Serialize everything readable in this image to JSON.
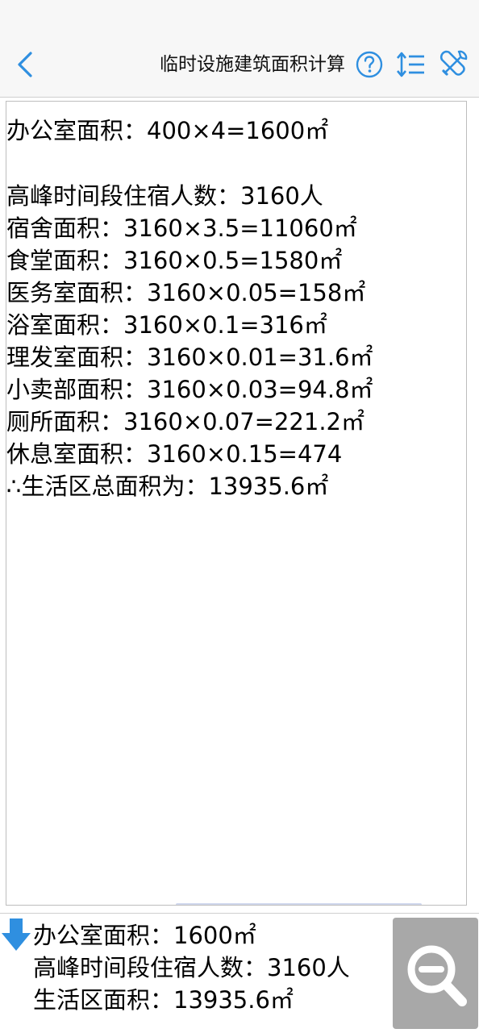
{
  "navbar": {
    "title": "临时设施建筑面积计算"
  },
  "icons": {
    "back": "chevron-left-icon",
    "help": "question-circle-icon",
    "sort": "sort-list-icon",
    "tools": "wrench-screwdriver-icon",
    "down": "arrow-down-icon",
    "zoom": "zoom-out-icon"
  },
  "colors": {
    "accent": "#2f8fe0",
    "zoom_bg": "#a8a8a8"
  },
  "results": [
    "办公室面积：400×4=1600㎡",
    "",
    "高峰时间段住宿人数：3160人",
    "宿舍面积：3160×3.5=11060㎡",
    "食堂面积：3160×0.5=1580㎡",
    "医务室面积：3160×0.05=158㎡",
    "浴室面积：3160×0.1=316㎡",
    "理发室面积：3160×0.01=31.6㎡",
    "小卖部面积：3160×0.03=94.8㎡",
    "厕所面积：3160×0.07=221.2㎡",
    "休息室面积：3160×0.15=474",
    "∴生活区总面积为：13935.6㎡"
  ],
  "summary": [
    "办公室面积：1600㎡",
    "高峰时间段住宿人数：3160人",
    "生活区面积：13935.6㎡"
  ]
}
